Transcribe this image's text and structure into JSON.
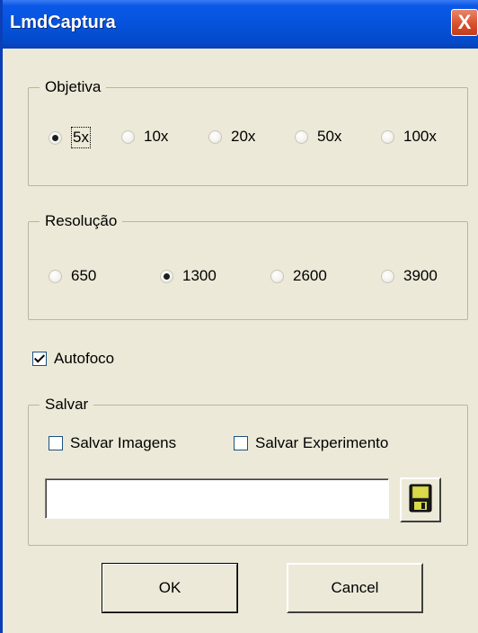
{
  "window": {
    "title": "LmdCaptura",
    "close_label": "X"
  },
  "objetiva": {
    "legend": "Objetiva",
    "options": [
      {
        "label": "5x",
        "checked": true
      },
      {
        "label": "10x",
        "checked": false
      },
      {
        "label": "20x",
        "checked": false
      },
      {
        "label": "50x",
        "checked": false
      },
      {
        "label": "100x",
        "checked": false
      }
    ]
  },
  "resolucao": {
    "legend": "Resolução",
    "options": [
      {
        "label": "650",
        "checked": false
      },
      {
        "label": "1300",
        "checked": true
      },
      {
        "label": "2600",
        "checked": false
      },
      {
        "label": "3900",
        "checked": false
      }
    ]
  },
  "autofoco": {
    "label": "Autofoco",
    "checked": true
  },
  "salvar": {
    "legend": "Salvar",
    "salvar_imagens": {
      "label": "Salvar Imagens",
      "checked": false
    },
    "salvar_experimento": {
      "label": "Salvar Experimento",
      "checked": false
    },
    "path_value": "",
    "save_icon": "floppy-disk-icon"
  },
  "buttons": {
    "ok_label": "OK",
    "cancel_label": "Cancel"
  }
}
